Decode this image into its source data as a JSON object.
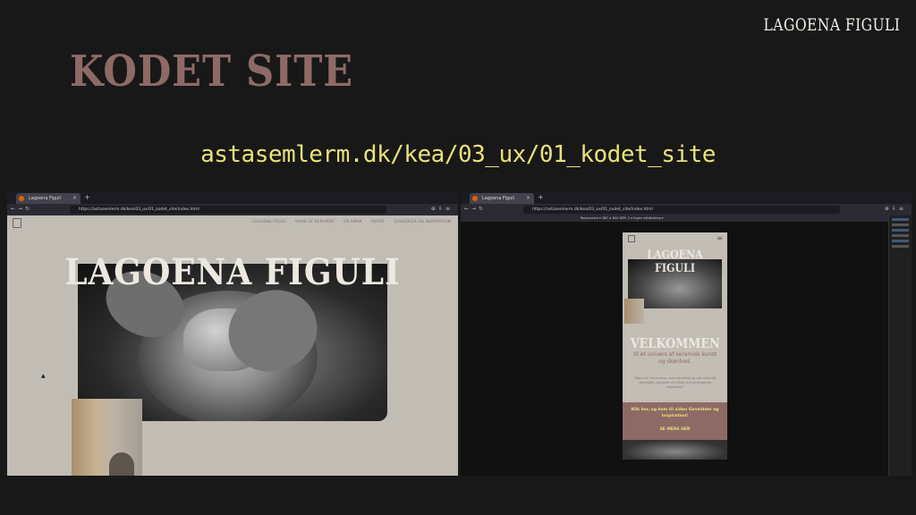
{
  "slide": {
    "brand": "LAGOENA FIGULI",
    "title": "KODET SITE",
    "url": "astasemlerm.dk/kea/03_ux/01_kodet_site"
  },
  "browser_left": {
    "tab_title": "Lagoena Figuli",
    "address": "https://astasemlerm.dk/kea/03_ux/01_kodet_site/index.html",
    "nav_links": [
      "LAGOENA FIGULI",
      "VIVAE OF KERAMIKT",
      "EN SMAK",
      "HVORT",
      "GAVEIDEER OG INSPIRATION"
    ],
    "hero_title": "LAGOENA FIGULI"
  },
  "browser_right": {
    "tab_title": "Lagoena Figuli",
    "address": "https://astasemlerm.dk/kea/03_ux/01_kodet_site/index.html",
    "responsive_bar": "Responsive ▾   380 × 844   DPR: 2 ▾   Ingen netdrosling ▾",
    "mobile": {
      "hero_title": "LAGOENA FIGULI",
      "welcome": "VELKOMMEN",
      "subtitle": "til et univers af keramisk kunst og skønhed.",
      "quote": "\"Sæd ind i et univers, hvor keramisk gjr sat med stilt skinstider, og bliver en trikke til e muknoende inspiration\"",
      "cta_text": "Klik her, og kom til siden Gaveidéer og inspiration!",
      "cta_button": "SE MERE HER"
    }
  },
  "colors": {
    "background": "#181818",
    "title": "#8e6a66",
    "url": "#e8e27a",
    "site_bg": "#c1bdb5"
  }
}
